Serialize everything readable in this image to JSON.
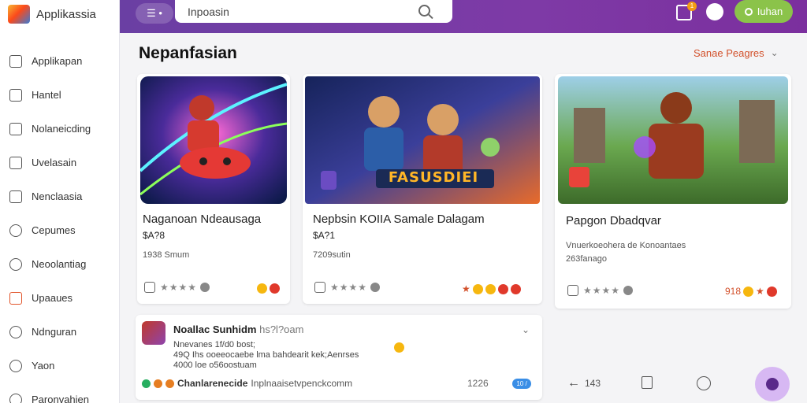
{
  "app": {
    "name": "Applikassia"
  },
  "colors": {
    "accent": "#7b3aa6",
    "login": "#8bc34a",
    "sort": "#d2502a"
  },
  "sidebar": {
    "items": [
      {
        "label": "Applikapan",
        "icon": "square-icon"
      },
      {
        "label": "Hantel",
        "icon": "chart-icon"
      },
      {
        "label": "Nolaneicding",
        "icon": "check-square-icon"
      },
      {
        "label": "Uvelasain",
        "icon": "columns-icon"
      },
      {
        "label": "Nenclaasia",
        "icon": "document-icon"
      },
      {
        "label": "Cepumes",
        "icon": "user-icon"
      },
      {
        "label": "Neoolantiag",
        "icon": "search-icon"
      },
      {
        "label": "Upaaues",
        "icon": "mail-icon"
      },
      {
        "label": "Ndnguran",
        "icon": "chat-icon"
      },
      {
        "label": "Yaon",
        "icon": "key-icon"
      },
      {
        "label": "Paronvahien",
        "icon": "person-icon"
      }
    ]
  },
  "topbar": {
    "menu_label": "☰ •",
    "search_value": "Inpoasin",
    "notif_count": "1",
    "login_label": "Iuhan"
  },
  "main": {
    "title": "Nepanfasian",
    "sort_label": "Sanae Peagres",
    "cards": [
      {
        "title": "Naganoan Ndeausaga",
        "price": "$A?8",
        "meta": [
          "1938 Smum"
        ],
        "rating": "★★★★",
        "banner": ""
      },
      {
        "title": "Nepbsin  KOIIA Samale Dalagam",
        "price": "$A?1",
        "meta": [
          "7209sutin"
        ],
        "rating": "★★★★",
        "banner": "FASUSDIEI"
      },
      {
        "title": "Papgon Dbadqvar",
        "price": "",
        "meta": [
          "Vnuerkoeohera de Konoantaes",
          "263fanago"
        ],
        "rating": "★★★★",
        "right": "918"
      }
    ],
    "wide": {
      "head": "Noallac Sunhidm",
      "head_sub": "hs?l?oam",
      "lines": [
        "Nnevanes 1f/d0 bost;",
        "49Q Ihs ooeeocaebe lma bahdearit kek;Aenrses",
        "4000 loe o56oostuam"
      ],
      "foot_text": "Chanlarenecide",
      "foot_url": "Inplnaaisetvpenckcomm",
      "num": "1226",
      "pill": "10 /"
    },
    "bottom": {
      "back_count": "143"
    }
  }
}
